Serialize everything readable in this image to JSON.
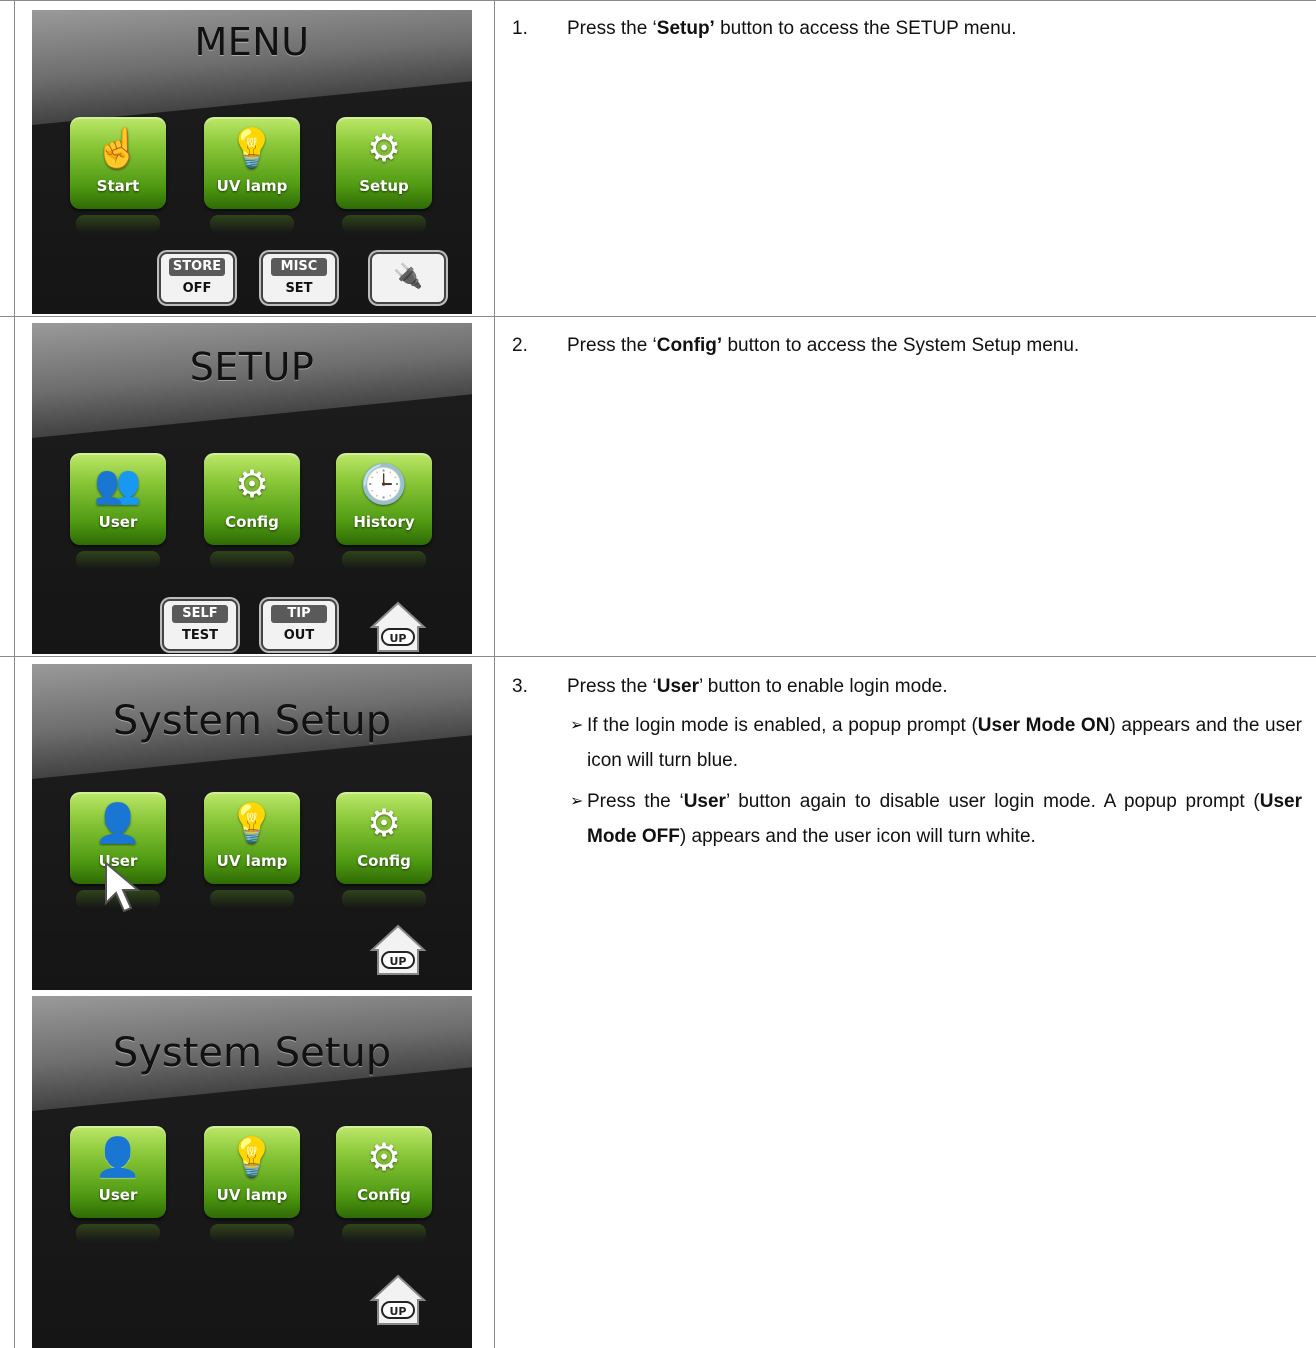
{
  "rows": [
    {
      "screen": {
        "title": "MENU",
        "buttons": [
          {
            "label": "Start",
            "icon": "hand-pointer-icon"
          },
          {
            "label": "UV lamp",
            "icon": "lightbulb-icon"
          },
          {
            "label": "Setup",
            "icon": "gears-icon"
          }
        ],
        "small_buttons": [
          {
            "top": "STORE",
            "bottom": "OFF"
          },
          {
            "top": "MISC",
            "bottom": "SET"
          },
          {
            "icon": "plug-icon"
          }
        ]
      },
      "step": {
        "number": "1.",
        "pre": "Press the ‘",
        "bold": "Setup’",
        "post": " button to access the SETUP menu."
      }
    },
    {
      "screen": {
        "title": "SETUP",
        "buttons": [
          {
            "label": "User",
            "icon": "users-icon"
          },
          {
            "label": "Config",
            "icon": "gear-icon"
          },
          {
            "label": "History",
            "icon": "clock-icon"
          }
        ],
        "small_buttons": [
          {
            "top": "SELF",
            "bottom": "TEST"
          },
          {
            "top": "TIP",
            "bottom": "OUT"
          }
        ],
        "home_label": "UP"
      },
      "step": {
        "number": "2.",
        "pre": "Press the ‘",
        "bold": "Config’",
        "post": " button to access the System Setup menu."
      }
    },
    {
      "screens": [
        {
          "title": "System Setup",
          "buttons": [
            {
              "label": "User",
              "icon": "user-card-icon"
            },
            {
              "label": "UV lamp",
              "icon": "lightbulb-icon"
            },
            {
              "label": "Config",
              "icon": "gear-icon"
            }
          ],
          "home_label": "UP",
          "cursor": "pointer-cursor-icon"
        },
        {
          "title": "System Setup",
          "buttons": [
            {
              "label": "User",
              "icon": "user-card-blue-icon"
            },
            {
              "label": "UV lamp",
              "icon": "lightbulb-icon"
            },
            {
              "label": "Config",
              "icon": "gear-icon"
            }
          ],
          "home_label": "UP"
        }
      ],
      "step": {
        "number": "3.",
        "pre": "Press the ‘",
        "bold": "User",
        "post": "’ button to enable login mode.",
        "bullets": [
          {
            "t1": "If the login mode is enabled, a popup prompt (",
            "b1": "User Mode ON",
            "t2": ") appears and the user icon will turn blue."
          },
          {
            "t1": "Press the ‘",
            "b1": "User",
            "t2": "’ button again to disable user login mode. A popup prompt (",
            "b2": "User Mode OFF",
            "t3": ") appears and the user icon will turn white."
          }
        ]
      }
    }
  ],
  "colors": {
    "button_green": "#6fb324",
    "user_blue": "#1a64d8",
    "screen_bg": "#1a1a1a"
  }
}
